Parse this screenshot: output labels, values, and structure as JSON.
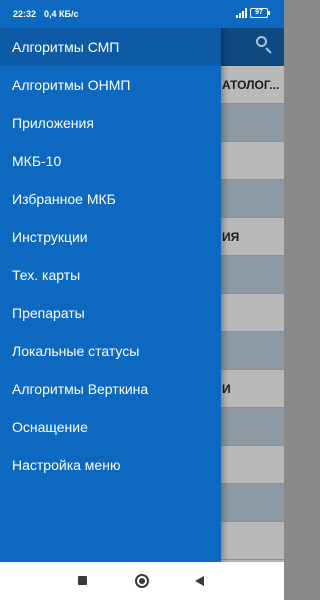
{
  "status": {
    "time": "22:32",
    "speed": "0,4 КБ/с",
    "battery": "97"
  },
  "background": {
    "rows": [
      {
        "text": "АТОЛОГ...",
        "shade": "white"
      },
      {
        "text": "",
        "shade": "gray"
      },
      {
        "text": "",
        "shade": "white"
      },
      {
        "text": "",
        "shade": "gray"
      },
      {
        "text": "ИЯ",
        "shade": "white"
      },
      {
        "text": "",
        "shade": "gray"
      },
      {
        "text": "",
        "shade": "white"
      },
      {
        "text": "",
        "shade": "gray"
      },
      {
        "text": "И",
        "shade": "white"
      },
      {
        "text": "",
        "shade": "gray"
      },
      {
        "text": "",
        "shade": "white"
      },
      {
        "text": "",
        "shade": "gray"
      },
      {
        "text": "",
        "shade": "white"
      }
    ]
  },
  "drawer": {
    "items": [
      {
        "label": "Алгоритмы СМП"
      },
      {
        "label": "Алгоритмы ОНМП"
      },
      {
        "label": "Приложения"
      },
      {
        "label": "МКБ-10"
      },
      {
        "label": "Избранное МКБ"
      },
      {
        "label": "Инструкции"
      },
      {
        "label": "Тех. карты"
      },
      {
        "label": "Препараты"
      },
      {
        "label": "Локальные статусы"
      },
      {
        "label": "Алгоритмы Верткина"
      },
      {
        "label": "Оснащение"
      },
      {
        "label": "Настройка меню"
      }
    ]
  },
  "colors": {
    "drawer": "#0d68c0",
    "active_item": "#0d5aa6",
    "appbar": "#0e4a80"
  }
}
